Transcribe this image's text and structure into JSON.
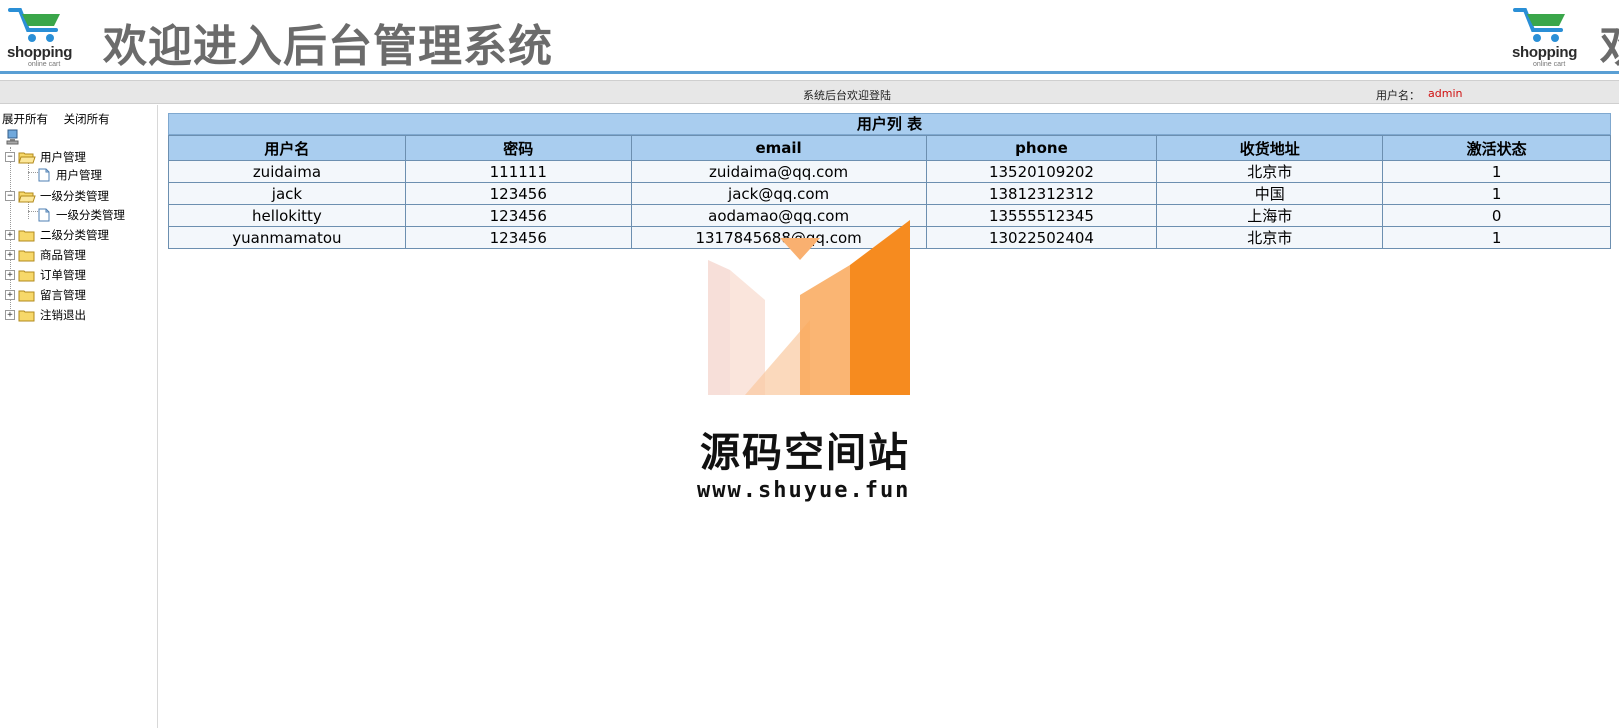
{
  "header": {
    "brand_name": "shopping",
    "brand_sub": "online cart",
    "title": "欢迎进入后台管理系统",
    "title_repeat": "欢"
  },
  "statusbar": {
    "welcome": "系统后台欢迎登陆",
    "user_label": "用户名：",
    "user_value": "admin"
  },
  "sidebar": {
    "expand_all": "展开所有",
    "collapse_all": "关闭所有",
    "items": [
      {
        "label": "用户管理",
        "expanded": true
      },
      {
        "label": "用户管理",
        "leaf": true
      },
      {
        "label": "一级分类管理",
        "expanded": true
      },
      {
        "label": "一级分类管理",
        "leaf": true
      },
      {
        "label": "二级分类管理",
        "expanded": false
      },
      {
        "label": "商品管理",
        "expanded": false
      },
      {
        "label": "订单管理",
        "expanded": false
      },
      {
        "label": "留言管理",
        "expanded": false
      },
      {
        "label": "注销退出",
        "expanded": false
      }
    ]
  },
  "table": {
    "caption": "用户列 表",
    "columns": [
      "用户名",
      "密码",
      "email",
      "phone",
      "收货地址",
      "激活状态"
    ],
    "rows": [
      [
        "zuidaima",
        "111111",
        "zuidaima@qq.com",
        "13520109202",
        "北京市",
        "1"
      ],
      [
        "jack",
        "123456",
        "jack@qq.com",
        "13812312312",
        "中国",
        "1"
      ],
      [
        "hellokitty",
        "123456",
        "aodamao@qq.com",
        "13555512345",
        "上海市",
        "0"
      ],
      [
        "yuanmamatou",
        "123456",
        "1317845688@qq.com",
        "13022502404",
        "北京市",
        "1"
      ]
    ]
  },
  "watermark": {
    "brand": "源码空间站",
    "url": "www.shuyue.fun"
  },
  "colors": {
    "header_accent": "#5a9fd4",
    "table_header": "#a9cdef",
    "user_value": "#d01010",
    "watermark_orange": "#f68b1f"
  }
}
